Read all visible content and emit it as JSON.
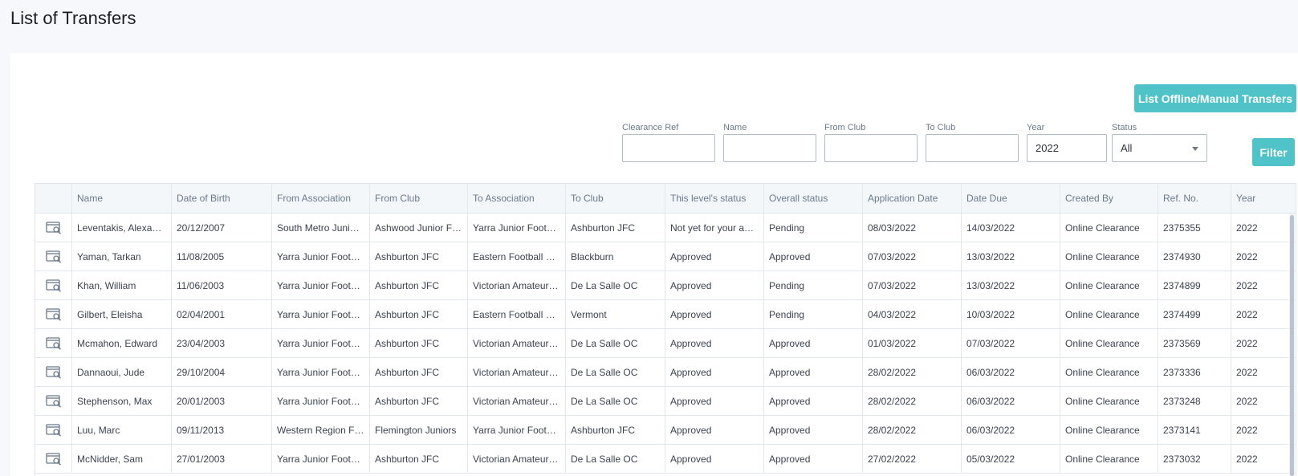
{
  "page": {
    "title": "List of Transfers"
  },
  "actions": {
    "offline_label": "List Offline/Manual Transfers",
    "filter_label": "Filter"
  },
  "filters": {
    "clearance_ref": {
      "label": "Clearance Ref",
      "value": ""
    },
    "name": {
      "label": "Name",
      "value": ""
    },
    "from_club": {
      "label": "From Club",
      "value": ""
    },
    "to_club": {
      "label": "To Club",
      "value": ""
    },
    "year": {
      "label": "Year",
      "value": "2022"
    },
    "status": {
      "label": "Status",
      "value": "All"
    }
  },
  "table": {
    "columns": [
      "",
      "Name",
      "Date of Birth",
      "From Association",
      "From Club",
      "To Association",
      "To Club",
      "This level's status",
      "Overall status",
      "Application Date",
      "Date Due",
      "Created By",
      "Ref. No.",
      "Year"
    ],
    "rows": [
      [
        "Leventakis, Alexand...",
        "20/12/2007",
        "South Metro Junior ...",
        "Ashwood Junior Fo...",
        "Yarra Junior Footba...",
        "Ashburton JFC",
        "Not yet for your app...",
        "Pending",
        "08/03/2022",
        "14/03/2022",
        "Online Clearance",
        "2375355",
        "2022"
      ],
      [
        "Yaman, Tarkan",
        "11/08/2005",
        "Yarra Junior Footba...",
        "Ashburton JFC",
        "Eastern Football Ne...",
        "Blackburn",
        "Approved",
        "Approved",
        "07/03/2022",
        "13/03/2022",
        "Online Clearance",
        "2374930",
        "2022"
      ],
      [
        "Khan, William",
        "11/06/2003",
        "Yarra Junior Footba...",
        "Ashburton JFC",
        "Victorian Amateur F...",
        "De La Salle OC",
        "Approved",
        "Pending",
        "07/03/2022",
        "13/03/2022",
        "Online Clearance",
        "2374899",
        "2022"
      ],
      [
        "Gilbert, Eleisha",
        "02/04/2001",
        "Yarra Junior Footba...",
        "Ashburton JFC",
        "Eastern Football Ne...",
        "Vermont",
        "Approved",
        "Pending",
        "04/03/2022",
        "10/03/2022",
        "Online Clearance",
        "2374499",
        "2022"
      ],
      [
        "Mcmahon, Edward",
        "23/04/2003",
        "Yarra Junior Footba...",
        "Ashburton JFC",
        "Victorian Amateur F...",
        "De La Salle OC",
        "Approved",
        "Approved",
        "01/03/2022",
        "07/03/2022",
        "Online Clearance",
        "2373569",
        "2022"
      ],
      [
        "Dannaoui, Jude",
        "29/10/2004",
        "Yarra Junior Footba...",
        "Ashburton JFC",
        "Victorian Amateur F...",
        "De La Salle OC",
        "Approved",
        "Approved",
        "28/02/2022",
        "06/03/2022",
        "Online Clearance",
        "2373336",
        "2022"
      ],
      [
        "Stephenson, Max",
        "20/01/2003",
        "Yarra Junior Footba...",
        "Ashburton JFC",
        "Victorian Amateur F...",
        "De La Salle OC",
        "Approved",
        "Approved",
        "28/02/2022",
        "06/03/2022",
        "Online Clearance",
        "2373248",
        "2022"
      ],
      [
        "Luu, Marc",
        "09/11/2013",
        "Western Region Fo...",
        "Flemington Juniors",
        "Yarra Junior Footba...",
        "Ashburton JFC",
        "Approved",
        "Approved",
        "28/02/2022",
        "06/03/2022",
        "Online Clearance",
        "2373141",
        "2022"
      ],
      [
        "McNidder, Sam",
        "27/01/2003",
        "Yarra Junior Footba...",
        "Ashburton JFC",
        "Victorian Amateur F...",
        "De La Salle OC",
        "Approved",
        "Approved",
        "27/02/2022",
        "05/03/2022",
        "Online Clearance",
        "2373032",
        "2022"
      ]
    ],
    "row_icon": "view-record-icon"
  },
  "colors": {
    "accent": "#4fc3c8",
    "background": "#f6f8fb",
    "border": "#dfe5ec"
  }
}
